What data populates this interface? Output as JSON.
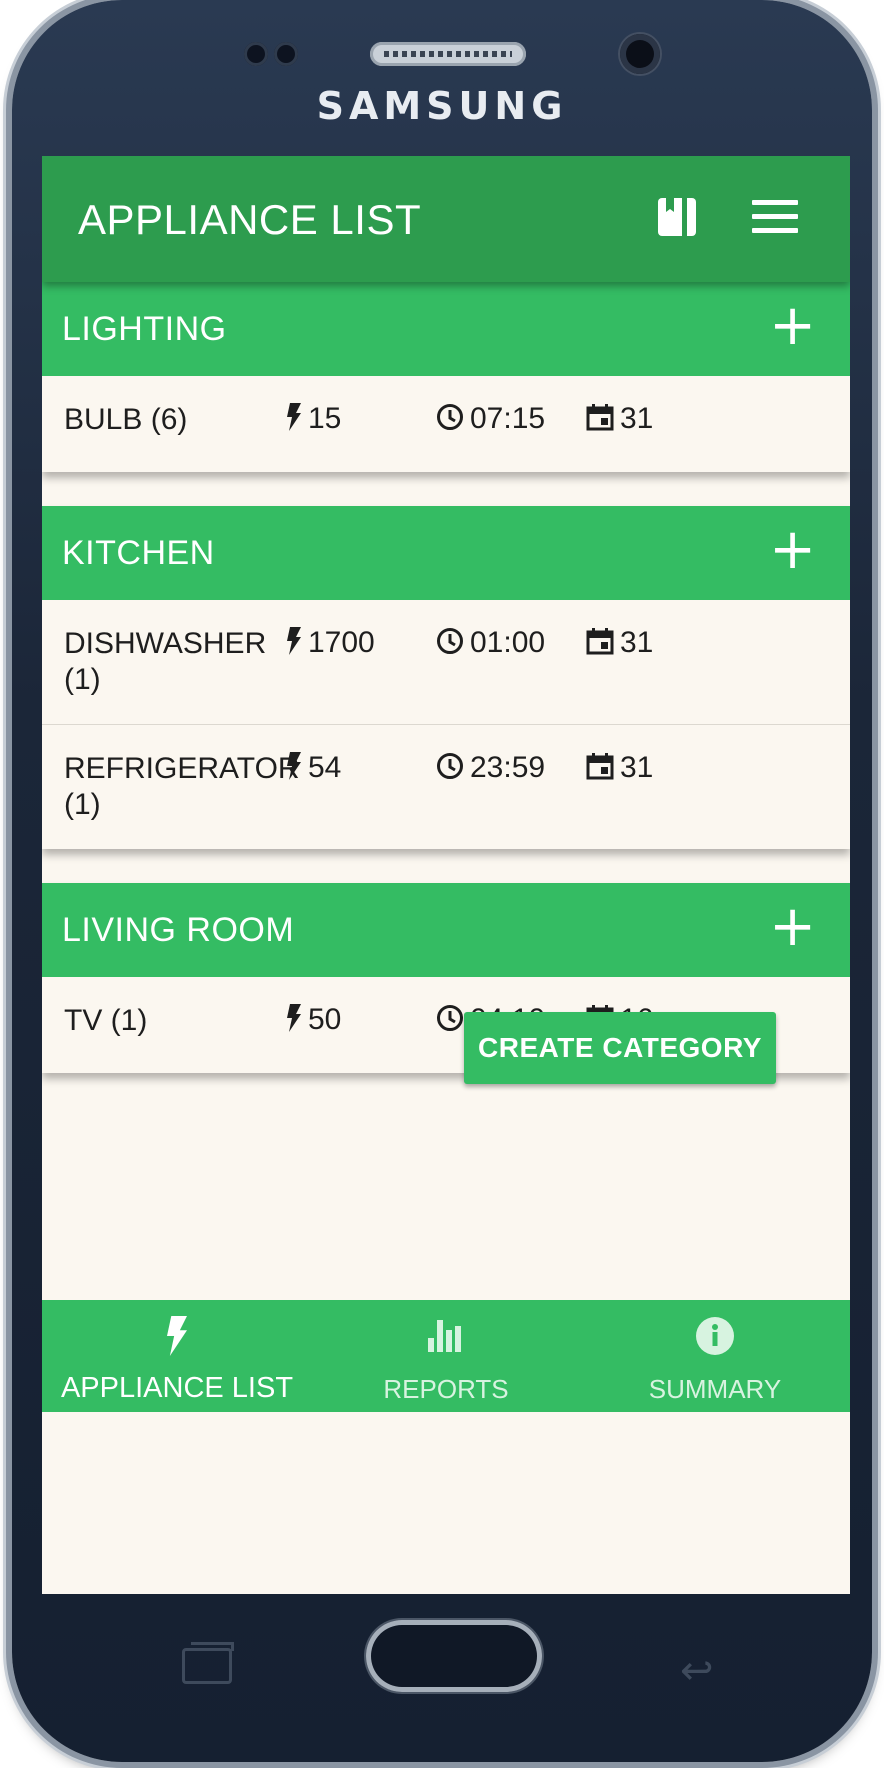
{
  "device": {
    "brand": "SAMSUNG"
  },
  "appbar": {
    "title": "APPLIANCE LIST",
    "icons": [
      "book-icon",
      "menu-icon"
    ]
  },
  "categories": [
    {
      "name": "LIGHTING",
      "add_label": "+",
      "items": [
        {
          "name": "BULB (6)",
          "watts": "15",
          "time": "07:15",
          "days": "31"
        }
      ]
    },
    {
      "name": "KITCHEN",
      "add_label": "+",
      "items": [
        {
          "name": "DISHWASHER (1)",
          "watts": "1700",
          "time": "01:00",
          "days": "31"
        },
        {
          "name": "REFRIGERATOR (1)",
          "watts": "54",
          "time": "23:59",
          "days": "31"
        }
      ]
    },
    {
      "name": "LIVING ROOM",
      "add_label": "+",
      "items": [
        {
          "name": "TV (1)",
          "watts": "50",
          "time": "04:10",
          "days": "16"
        }
      ]
    }
  ],
  "actions": {
    "create_category": "CREATE CATEGORY"
  },
  "bottom_nav": {
    "tabs": [
      {
        "label": "APPLIANCE LIST",
        "icon": "bolt-icon",
        "active": true
      },
      {
        "label": "REPORTS",
        "icon": "bar-chart-icon",
        "active": false
      },
      {
        "label": "SUMMARY",
        "icon": "info-icon",
        "active": false
      }
    ]
  },
  "colors": {
    "appbar": "#2d9c4e",
    "header": "#34bc63",
    "background": "#fbf7f0"
  }
}
